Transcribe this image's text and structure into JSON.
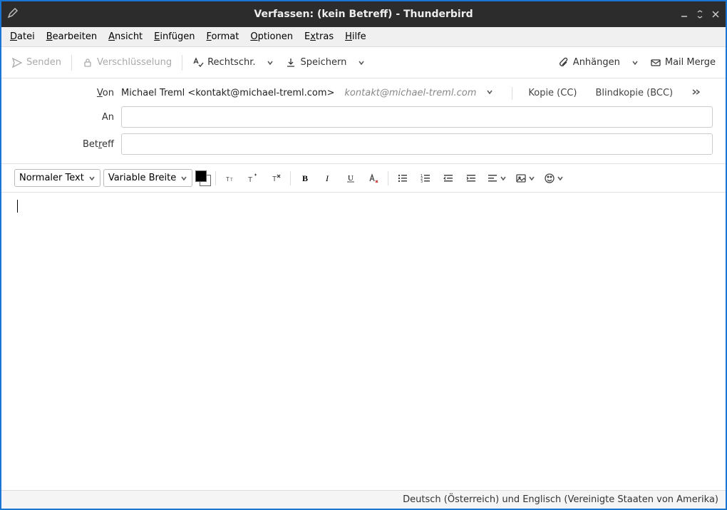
{
  "window": {
    "title": "Verfassen: (kein Betreff) - Thunderbird"
  },
  "menubar": {
    "items": [
      "Datei",
      "Bearbeiten",
      "Ansicht",
      "Einfügen",
      "Format",
      "Optionen",
      "Extras",
      "Hilfe"
    ],
    "underline_positions": [
      0,
      0,
      0,
      0,
      0,
      0,
      1,
      0
    ]
  },
  "toolbar": {
    "send": "Senden",
    "encrypt": "Verschlüsselung",
    "spell": "Rechtschr.",
    "save": "Speichern",
    "attach": "Anhängen",
    "mailmerge": "Mail Merge"
  },
  "fields": {
    "from_label_pre": "V",
    "from_label_post": "on",
    "from_name": "Michael Treml <kontakt@michael-treml.com>",
    "from_email": "kontakt@michael-treml.com",
    "cc": "Kopie (CC)",
    "bcc": "Blindkopie (BCC)",
    "to_label": "An",
    "to_value": "",
    "subject_label_pre": "Bet",
    "subject_label_u": "r",
    "subject_label_post": "eff",
    "subject_value": ""
  },
  "format": {
    "paragraph": "Normaler Text",
    "font": "Variable Breite"
  },
  "status": {
    "language": "Deutsch (Österreich) und Englisch (Vereinigte Staaten von Amerika)"
  }
}
